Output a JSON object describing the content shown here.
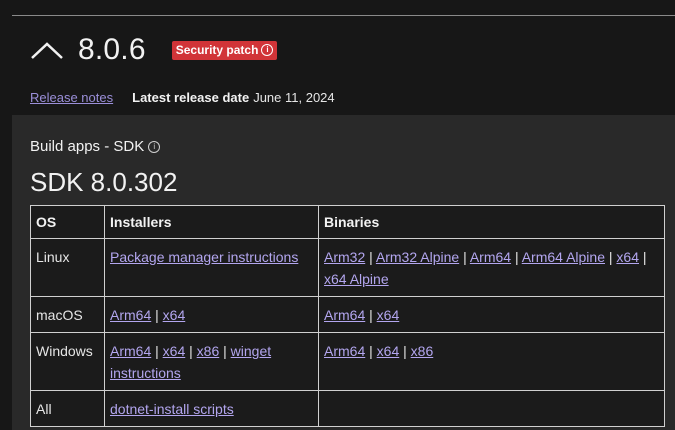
{
  "header": {
    "version": "8.0.6",
    "badge": "Security patch",
    "badge_icon": "info-icon",
    "collapse_icon": "chevron-up-icon",
    "badge_color": "#d13438"
  },
  "meta": {
    "release_notes": "Release notes",
    "latest_label": "Latest release date",
    "latest_value": "June 11, 2024"
  },
  "sdk": {
    "section_title": "Build apps - SDK",
    "section_icon": "info-icon",
    "version": "SDK 8.0.302",
    "table": {
      "headers": [
        "OS",
        "Installers",
        "Binaries"
      ],
      "rows": [
        {
          "os": "Linux",
          "installers": [
            "Package manager instructions"
          ],
          "binaries": [
            "Arm32",
            "Arm32 Alpine",
            "Arm64",
            "Arm64 Alpine",
            "x64",
            "x64 Alpine"
          ]
        },
        {
          "os": "macOS",
          "installers": [
            "Arm64",
            "x64"
          ],
          "binaries": [
            "Arm64",
            "x64"
          ]
        },
        {
          "os": "Windows",
          "installers": [
            "Arm64",
            "x64",
            "x86",
            "winget instructions"
          ],
          "binaries": [
            "Arm64",
            "x64",
            "x86"
          ]
        },
        {
          "os": "All",
          "installers": [
            "dotnet-install scripts"
          ],
          "binaries": []
        }
      ]
    }
  },
  "colors": {
    "background": "#171717",
    "panel": "#292929",
    "link": "#b3a6ef"
  }
}
